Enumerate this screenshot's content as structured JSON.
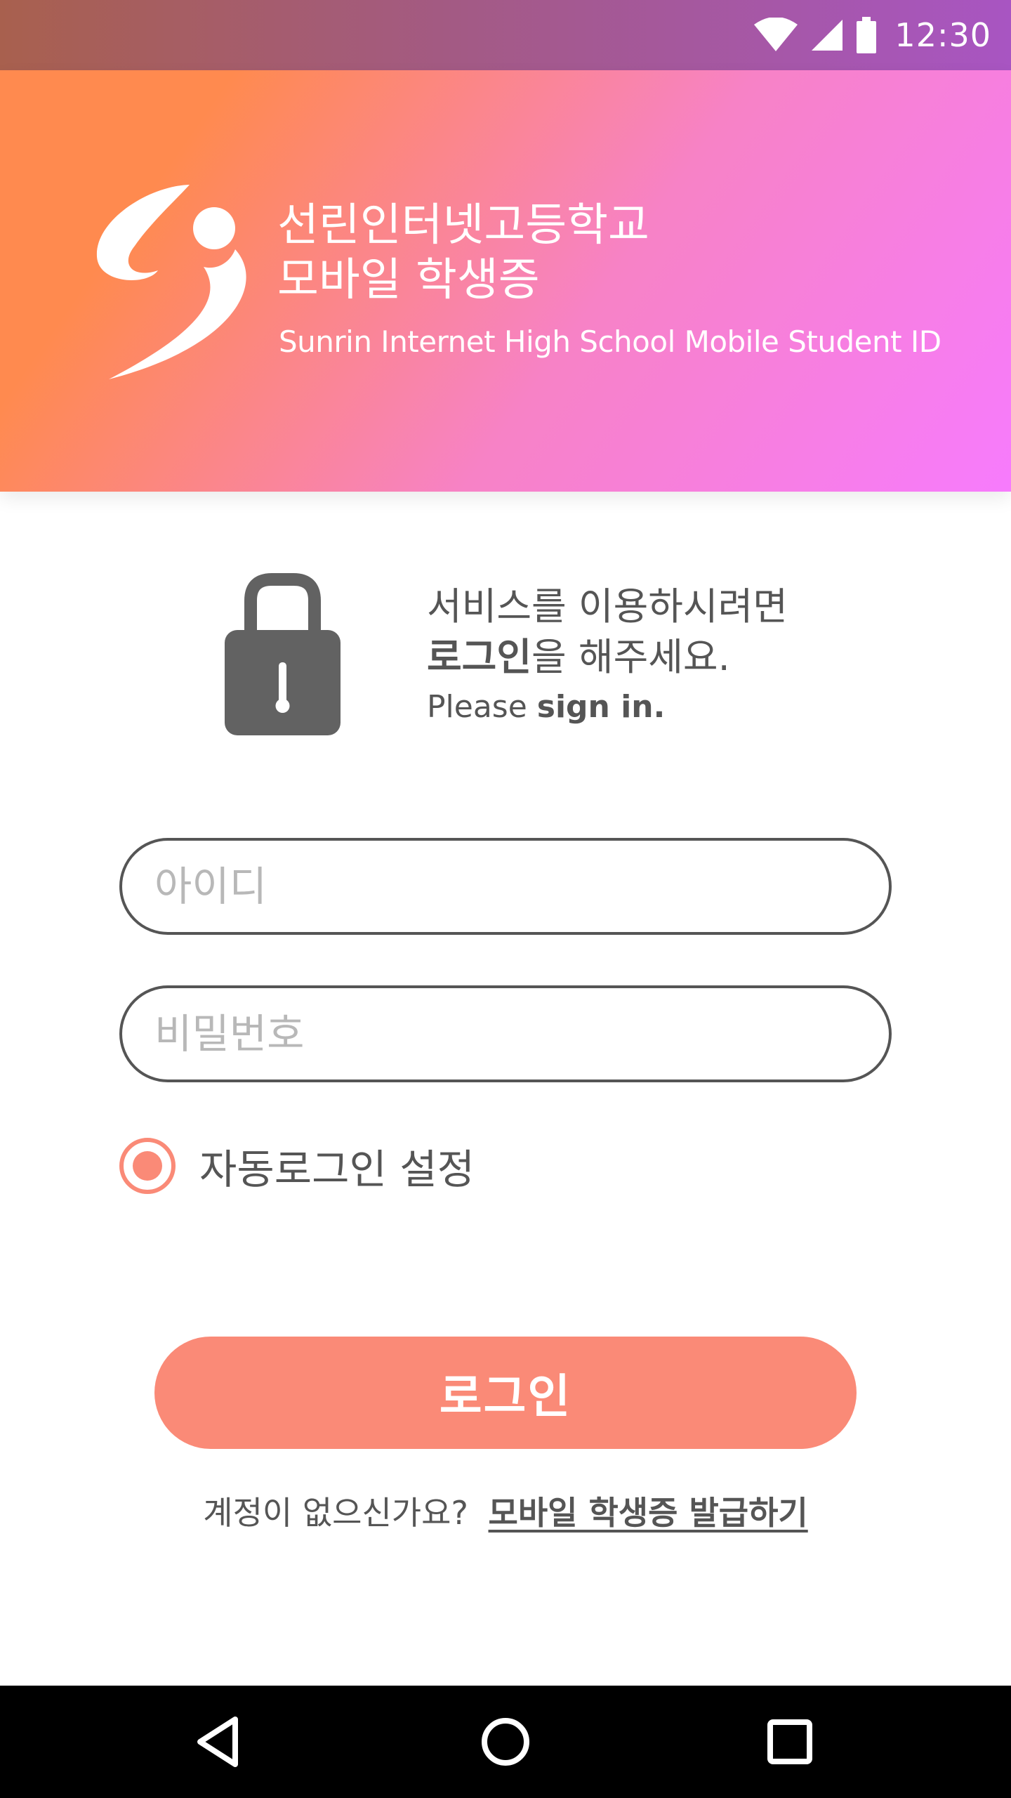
{
  "status_bar": {
    "time": "12:30",
    "icons": [
      "wifi-icon",
      "cell-signal-icon",
      "battery-icon"
    ]
  },
  "header": {
    "school_name_line1": "선린인터넷고등학교",
    "school_name_line2": "모바일 학생증",
    "school_name_english": "Sunrin Internet High School Mobile Student ID",
    "logo": "school-logo",
    "gradient_colors": [
      "#ff8a4f",
      "#f782c6",
      "#f77bfd"
    ]
  },
  "prompt": {
    "icon": "lock-icon",
    "line1": "서비스를 이용하시려면",
    "line2_strong": "로그인",
    "line2_rest": "을 해주세요.",
    "line3_prefix": "Please ",
    "line3_strong": "sign in."
  },
  "form": {
    "id_placeholder": "아이디",
    "id_value": "",
    "password_placeholder": "비밀번호",
    "password_value": "",
    "auto_login_label": "자동로그인 설정",
    "auto_login_checked": true
  },
  "login_button_label": "로그인",
  "signup": {
    "question": "계정이 없으신가요?",
    "link_label": "모바일 학생증 발급하기"
  },
  "nav_bar": {
    "buttons": [
      "back-icon",
      "home-icon",
      "recents-icon"
    ]
  },
  "colors": {
    "accent": "#fa8a77",
    "text": "#555555",
    "placeholder": "#b8b8b8"
  }
}
